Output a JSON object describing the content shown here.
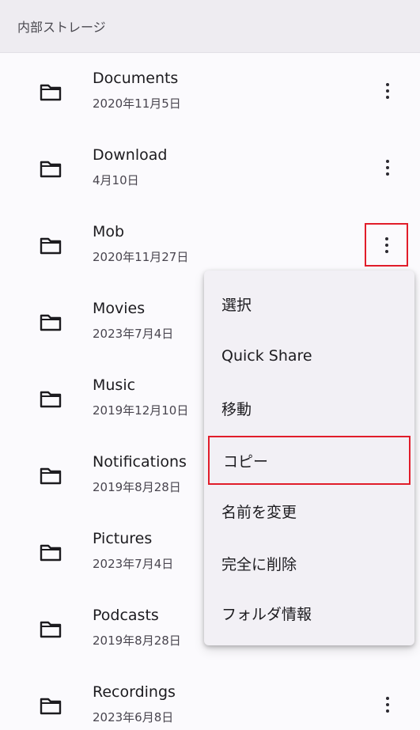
{
  "header": {
    "title": "内部ストレージ"
  },
  "folders": [
    {
      "name": "Documents",
      "date": "2020年11月5日"
    },
    {
      "name": "Download",
      "date": "4月10日"
    },
    {
      "name": "Mob",
      "date": "2020年11月27日"
    },
    {
      "name": "Movies",
      "date": "2023年7月4日"
    },
    {
      "name": "Music",
      "date": "2019年12月10日"
    },
    {
      "name": "Notifications",
      "date": "2019年8月28日"
    },
    {
      "name": "Pictures",
      "date": "2023年7月4日"
    },
    {
      "name": "Podcasts",
      "date": "2019年8月28日"
    },
    {
      "name": "Recordings",
      "date": "2023年6月8日"
    }
  ],
  "menu": {
    "items": [
      {
        "label": "選択"
      },
      {
        "label": "Quick Share"
      },
      {
        "label": "移動"
      },
      {
        "label": "コピー"
      },
      {
        "label": "名前を変更"
      },
      {
        "label": "完全に削除"
      },
      {
        "label": "フォルダ情報"
      }
    ]
  },
  "colors": {
    "highlight": "#e11d2a",
    "menu_bg": "#f2f0f5",
    "header_bg": "#eeecf1"
  },
  "icons": {
    "folder": "folder-icon",
    "more": "more-vert-icon"
  }
}
